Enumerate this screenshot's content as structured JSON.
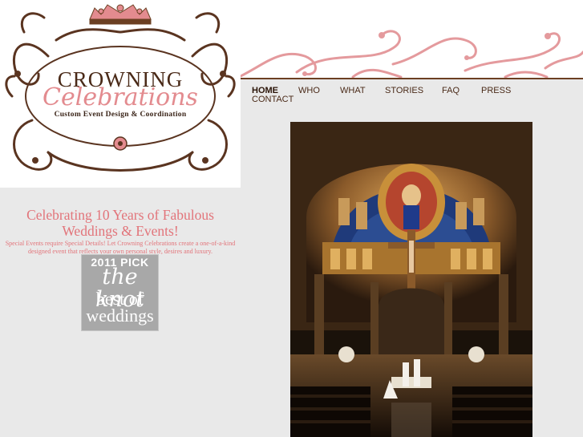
{
  "logo": {
    "line1": "CROWNING",
    "line2": "Celebrations",
    "tagline": "Custom Event Design & Coordination"
  },
  "nav": {
    "items": [
      {
        "label": "HOME",
        "active": true
      },
      {
        "label": "WHO",
        "active": false
      },
      {
        "label": "WHAT",
        "active": false
      },
      {
        "label": "STORIES",
        "active": false
      },
      {
        "label": "FAQ",
        "active": false
      },
      {
        "label": "PRESS",
        "active": false
      },
      {
        "label": "CONTACT",
        "active": false
      }
    ]
  },
  "intro": {
    "headline": "Celebrating 10 Years of Fabulous Weddings & Events!",
    "body": "Special Events require Special Details! Let Crowning Celebrations create a one-of-a-kind designed event that reflects your own personal style, desires and luxury."
  },
  "badge": {
    "year_pick": "2011 PICK",
    "brand": "the knot",
    "line1": "best of",
    "line2": "weddings"
  },
  "colors": {
    "accent_pink": "#e2747a",
    "brown": "#4a2a18",
    "page_bg": "#e9e9e9"
  }
}
